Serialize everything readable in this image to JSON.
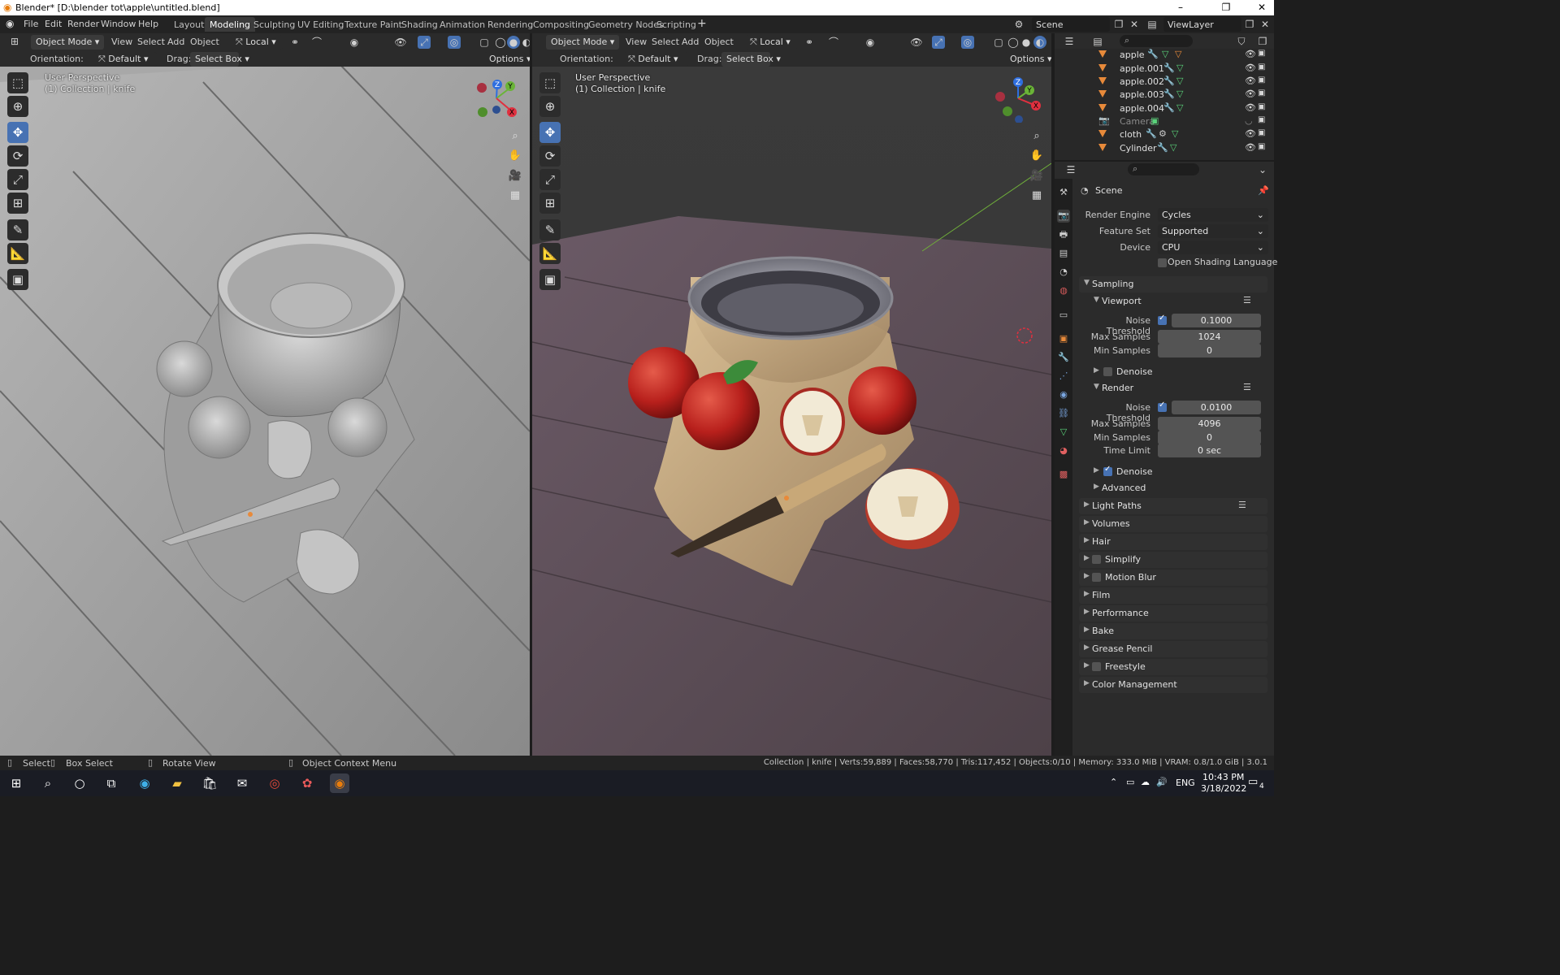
{
  "window": {
    "title": "Blender* [D:\\blender tot\\apple\\untitled.blend]",
    "minimize": "–",
    "maximize": "❐",
    "close": "✕"
  },
  "menu": [
    "File",
    "Edit",
    "Render",
    "Window",
    "Help"
  ],
  "workspaces": [
    "Layout",
    "Modeling",
    "Sculpting",
    "UV Editing",
    "Texture Paint",
    "Shading",
    "Animation",
    "Rendering",
    "Compositing",
    "Geometry Nodes",
    "Scripting"
  ],
  "active_workspace": "Modeling",
  "scene": {
    "name": "Scene",
    "viewlayer": "ViewLayer"
  },
  "viewport_header": {
    "mode": "Object Mode",
    "menus": [
      "View",
      "Select",
      "Add",
      "Object"
    ],
    "pivot": "Local",
    "orientation_label": "Orientation:",
    "orientation_value": "Default",
    "drag_label": "Drag:",
    "drag_value": "Select Box",
    "options": "Options"
  },
  "viewport_left": {
    "perspective": "User Perspective",
    "collection": "(1) Collection | knife"
  },
  "viewport_right": {
    "perspective": "User Perspective",
    "collection": "(1) Collection | knife"
  },
  "gizmo_axes": {
    "x": "X",
    "y": "Y",
    "z": "Z"
  },
  "outliner": {
    "items": [
      {
        "name": "apple"
      },
      {
        "name": "apple.001"
      },
      {
        "name": "apple.002"
      },
      {
        "name": "apple.003"
      },
      {
        "name": "apple.004"
      },
      {
        "name": "Camera"
      },
      {
        "name": "cloth"
      },
      {
        "name": "Cylinder"
      }
    ]
  },
  "properties": {
    "context": "Scene",
    "render_engine": {
      "label": "Render Engine",
      "value": "Cycles"
    },
    "feature_set": {
      "label": "Feature Set",
      "value": "Supported"
    },
    "device": {
      "label": "Device",
      "value": "CPU"
    },
    "osl": {
      "label": "Open Shading Language",
      "checked": false
    },
    "sampling": {
      "title": "Sampling",
      "viewport": {
        "title": "Viewport",
        "noise_threshold_label": "Noise Threshold",
        "noise_threshold": "0.1000",
        "noise_threshold_on": true,
        "max_samples_label": "Max Samples",
        "max_samples": "1024",
        "min_samples_label": "Min Samples",
        "min_samples": "0",
        "denoise_label": "Denoise",
        "denoise_on": false
      },
      "render": {
        "title": "Render",
        "noise_threshold_label": "Noise Threshold",
        "noise_threshold": "0.0100",
        "noise_threshold_on": true,
        "max_samples_label": "Max Samples",
        "max_samples": "4096",
        "min_samples_label": "Min Samples",
        "min_samples": "0",
        "time_limit_label": "Time Limit",
        "time_limit": "0 sec",
        "denoise_label": "Denoise",
        "denoise_on": true
      },
      "advanced": "Advanced"
    },
    "panels": [
      {
        "label": "Light Paths",
        "checkbox": false
      },
      {
        "label": "Volumes",
        "checkbox": false
      },
      {
        "label": "Hair",
        "checkbox": false
      },
      {
        "label": "Simplify",
        "checkbox": true
      },
      {
        "label": "Motion Blur",
        "checkbox": true
      },
      {
        "label": "Film",
        "checkbox": false
      },
      {
        "label": "Performance",
        "checkbox": false
      },
      {
        "label": "Bake",
        "checkbox": false
      },
      {
        "label": "Grease Pencil",
        "checkbox": false
      },
      {
        "label": "Freestyle",
        "checkbox": true
      },
      {
        "label": "Color Management",
        "checkbox": false
      }
    ]
  },
  "statusbar": {
    "select": "Select",
    "box_select": "Box Select",
    "rotate_view": "Rotate View",
    "context_menu": "Object Context Menu",
    "stats": "Collection | knife | Verts:59,889 | Faces:58,770 | Tris:117,452 | Objects:0/10 | Memory: 333.0 MiB | VRAM: 0.8/1.0 GiB | 3.0.1"
  },
  "taskbar": {
    "lang": "ENG",
    "time": "10:43 PM",
    "date": "3/18/2022",
    "notifications": "4"
  },
  "colors": {
    "accent": "#4772b3",
    "object_orange": "#e88a3a",
    "axis_x": "#e0303f",
    "axis_y": "#6ab437",
    "axis_z": "#2e6ee0"
  }
}
